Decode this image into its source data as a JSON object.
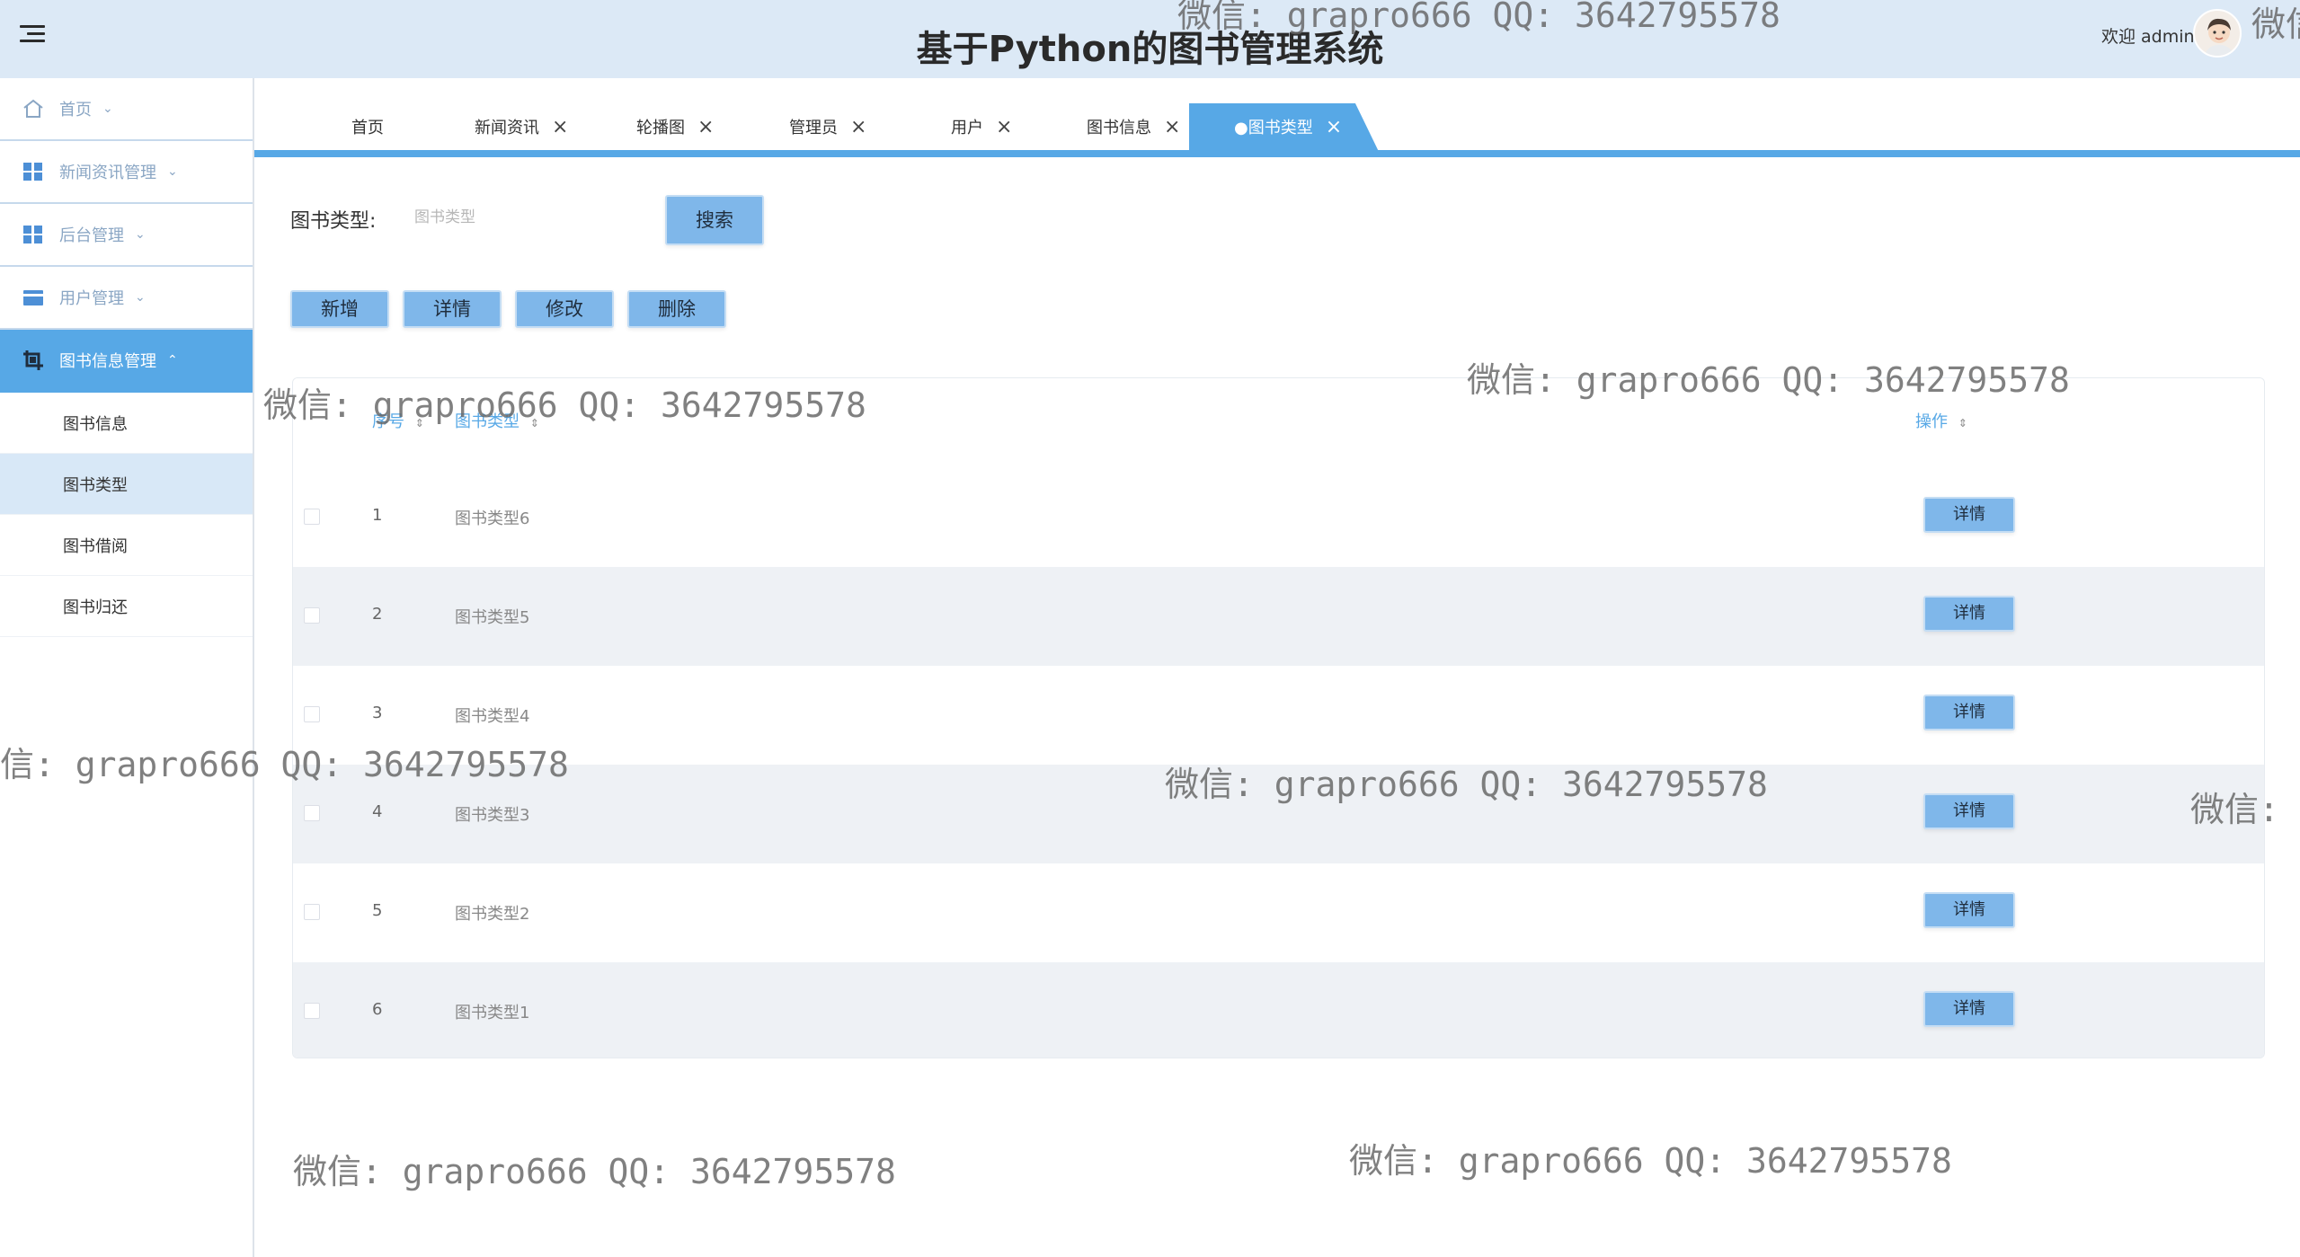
{
  "header": {
    "title": "基于Python的图书管理系统",
    "welcome": "欢迎 admin"
  },
  "sidebar": {
    "items": [
      {
        "label": "首页",
        "icon": "home-icon"
      },
      {
        "label": "新闻资讯管理",
        "icon": "grid-icon"
      },
      {
        "label": "后台管理",
        "icon": "grid-icon"
      },
      {
        "label": "用户管理",
        "icon": "card-icon"
      },
      {
        "label": "图书信息管理",
        "icon": "crop-icon"
      }
    ],
    "sub_items": [
      "图书信息",
      "图书类型",
      "图书借阅",
      "图书归还"
    ]
  },
  "tabs": [
    {
      "label": "首页"
    },
    {
      "label": "新闻资讯",
      "close": "×"
    },
    {
      "label": "轮播图",
      "close": "×"
    },
    {
      "label": "管理员",
      "close": "×"
    },
    {
      "label": "用户",
      "close": "×"
    },
    {
      "label": "图书信息",
      "close": "×"
    },
    {
      "label": "●图书类型",
      "close": "×"
    }
  ],
  "search": {
    "label": "图书类型:",
    "placeholder": "图书类型",
    "button": "搜索"
  },
  "actions": {
    "add": "新增",
    "detail": "详情",
    "edit": "修改",
    "delete": "删除"
  },
  "table": {
    "columns": {
      "index": "序号",
      "type": "图书类型",
      "ops": "操作"
    },
    "sort_glyph": "⇕",
    "detail_label": "详情",
    "rows": [
      {
        "idx": "1",
        "name": "图书类型6"
      },
      {
        "idx": "2",
        "name": "图书类型5"
      },
      {
        "idx": "3",
        "name": "图书类型4"
      },
      {
        "idx": "4",
        "name": "图书类型3"
      },
      {
        "idx": "5",
        "name": "图书类型2"
      },
      {
        "idx": "6",
        "name": "图书类型1"
      }
    ]
  },
  "watermark": {
    "text": "微信: grapro666 QQ: 3642795578",
    "fragment_left": "信: grapro666 QQ: 3642795578",
    "fragment_right": "微信:",
    "fragment_corner": "微信"
  },
  "colors": {
    "accent": "#57a8e6",
    "header_bg": "#dce9f6",
    "button": "#7fb7ea",
    "row_stripe": "#eef1f5"
  }
}
